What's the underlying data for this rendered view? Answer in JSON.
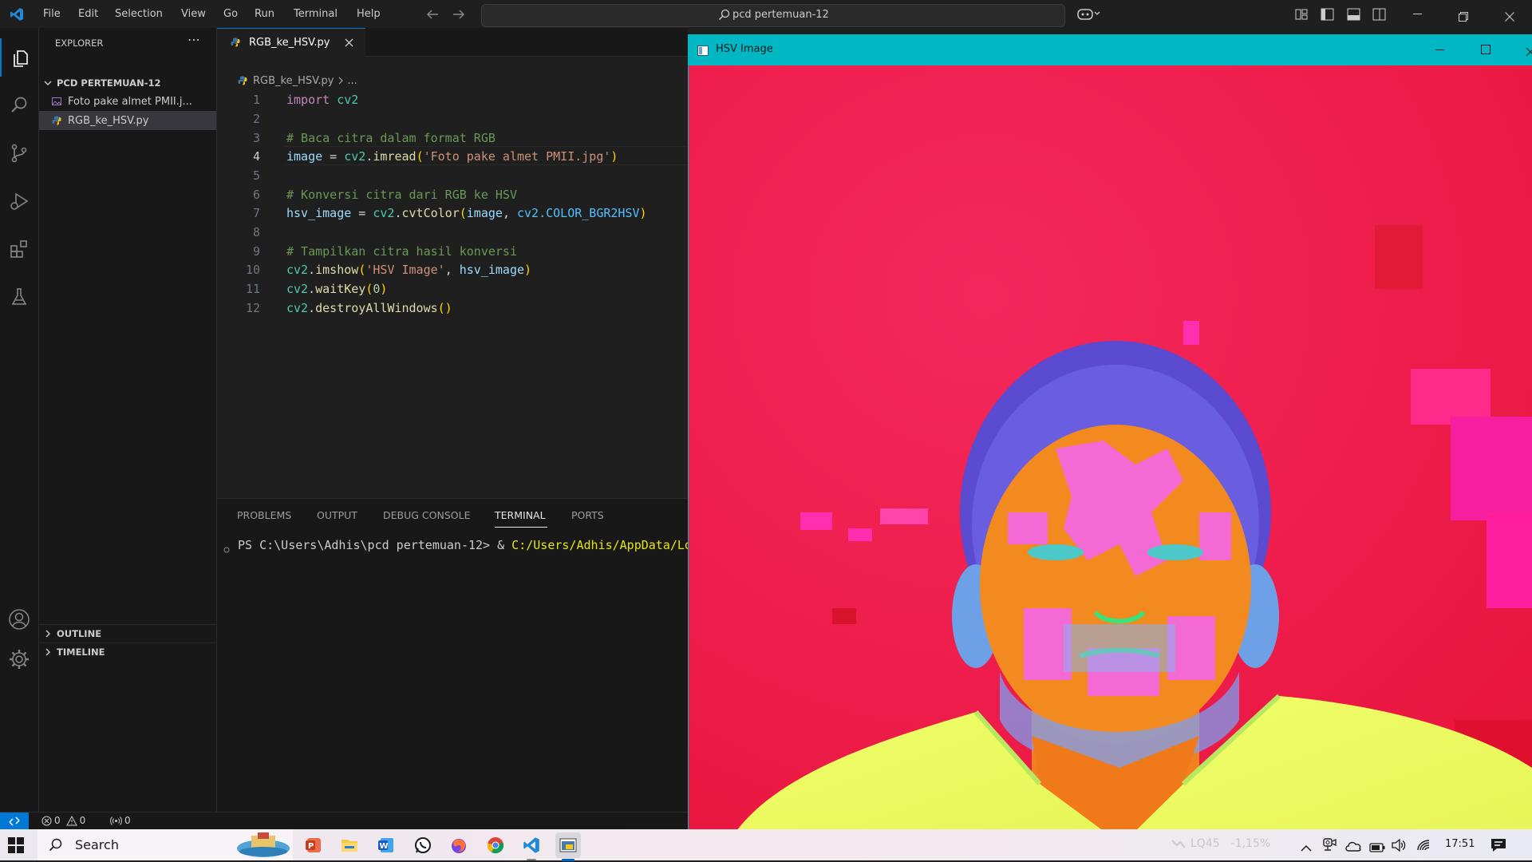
{
  "titlebar": {
    "menu": [
      "File",
      "Edit",
      "Selection",
      "View",
      "Go",
      "Run",
      "Terminal",
      "Help"
    ],
    "search": "pcd pertemuan-12"
  },
  "sidebar": {
    "title": "EXPLORER",
    "folder": "PCD PERTEMUAN-12",
    "files": [
      "Foto pake almet PMII.j...",
      "RGB_ke_HSV.py"
    ],
    "outline": "OUTLINE",
    "timeline": "TIMELINE"
  },
  "editor": {
    "tab": "RGB_ke_HSV.py",
    "breadcrumb_file": "RGB_ke_HSV.py",
    "breadcrumb_rest": "...",
    "line_numbers": [
      "1",
      "2",
      "3",
      "4",
      "5",
      "6",
      "7",
      "8",
      "9",
      "10",
      "11",
      "12"
    ]
  },
  "code": {
    "l1_kw": "import",
    "l1_mod": "cv2",
    "l3": "# Baca citra dalam format RGB",
    "l4_var": "image",
    "l4_eq": " = ",
    "l4_mod": "cv2",
    "l4_fn": "imread",
    "l4_str": "'Foto pake almet PMII.jpg'",
    "l6": "# Konversi citra dari RGB ke HSV",
    "l7_var": "hsv_image",
    "l7_eq": " = ",
    "l7_mod": "cv2",
    "l7_fn": "cvtColor",
    "l7_arg1": "image",
    "l7_sep": ", ",
    "l7_arg2": "cv2.COLOR_BGR2HSV",
    "l9": "# Tampilkan citra hasil konversi",
    "l10_mod": "cv2",
    "l10_fn": "imshow",
    "l10_str": "'HSV Image'",
    "l10_sep": ", ",
    "l10_arg": "hsv_image",
    "l11_mod": "cv2",
    "l11_fn": "waitKey",
    "l11_num": "0",
    "l12_mod": "cv2",
    "l12_fn": "destroyAllWindows"
  },
  "panel": {
    "tabs": [
      "PROBLEMS",
      "OUTPUT",
      "DEBUG CONSOLE",
      "TERMINAL",
      "PORTS"
    ],
    "prompt": "PS C:\\Users\\Adhis\\pcd pertemuan-12> & ",
    "path": "C:/Users/Adhis/AppData/Local/Programs/Python"
  },
  "statusbar": {
    "errors": "0",
    "warnings": "0",
    "ports": "0"
  },
  "window": {
    "title": "HSV Image"
  },
  "taskbar": {
    "search": "Search",
    "stock": "LQ45",
    "stock_change": "-1,15%",
    "time": "17:51"
  },
  "colors": {
    "accent": "#0078d4",
    "window_titlebar": "#00b7c3",
    "keyword": "#c586c0",
    "comment": "#6a9955",
    "string": "#ce9178",
    "function": "#dcdcaa",
    "variable": "#9cdcfe",
    "module": "#4ec9b0",
    "number": "#b5cea8"
  }
}
